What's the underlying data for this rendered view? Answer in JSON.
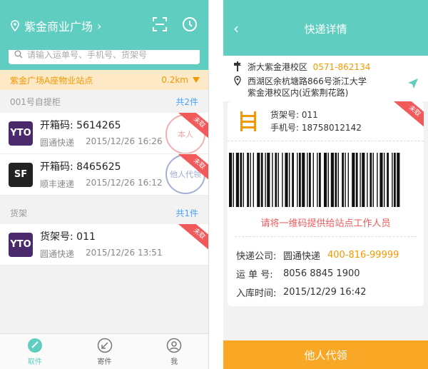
{
  "left": {
    "header": {
      "location": "紫金商业广场"
    },
    "search": {
      "placeholder": "请输入运单号、手机号、货架号"
    },
    "station": {
      "name": "紫金广场A座物业站点",
      "distance": "0.2km"
    },
    "sections": [
      {
        "title": "001号自提柜",
        "count": "共2件"
      },
      {
        "title": "货架",
        "count": "共1件"
      }
    ],
    "cards": [
      {
        "logo": "YTO",
        "main": "开箱码: 5614265",
        "company": "圆通快递",
        "time": "2015/12/26 16:26",
        "ribbon": "未取",
        "stamp": "本人"
      },
      {
        "logo": "SF",
        "main": "开箱码: 8465625",
        "company": "顺丰速递",
        "time": "2015/12/26 16:12",
        "ribbon": "未取",
        "stamp": "他人代领"
      },
      {
        "logo": "YTO",
        "main": "货架号: 011",
        "company": "圆通快递",
        "time": "2015/12/26 13:51",
        "ribbon": "未取"
      }
    ],
    "tabs": [
      {
        "label": "取件",
        "icon": "pickup-icon"
      },
      {
        "label": "寄件",
        "icon": "send-icon"
      },
      {
        "label": "我",
        "icon": "profile-icon"
      }
    ]
  },
  "right": {
    "title": "快递详情",
    "address": {
      "name": "浙大紫金港校区",
      "phone": "0571-862134",
      "line1": "西湖区余杭塘路866号浙江大学",
      "line2": "紫金港校区内(近紫荆花路)"
    },
    "ticket": {
      "shelf": "货架号:  011",
      "mobile": "手机号:  18758012142",
      "ribbon": "未取",
      "hint": "请将一维码提供给站点工作人员",
      "courier_label": "快递公司:",
      "courier": "圆通快递",
      "courier_phone": "400-816-99999",
      "waybill_label": "运 单 号:",
      "waybill": "8056 8845 1900",
      "date_label": "入库时间:",
      "date": "2015/12/29  16:42"
    },
    "button": "他人代领"
  },
  "colors": {
    "teal": "#5fcdc0",
    "orange": "#f39800",
    "red": "#f05a5a",
    "blue": "#4aa3ff"
  }
}
